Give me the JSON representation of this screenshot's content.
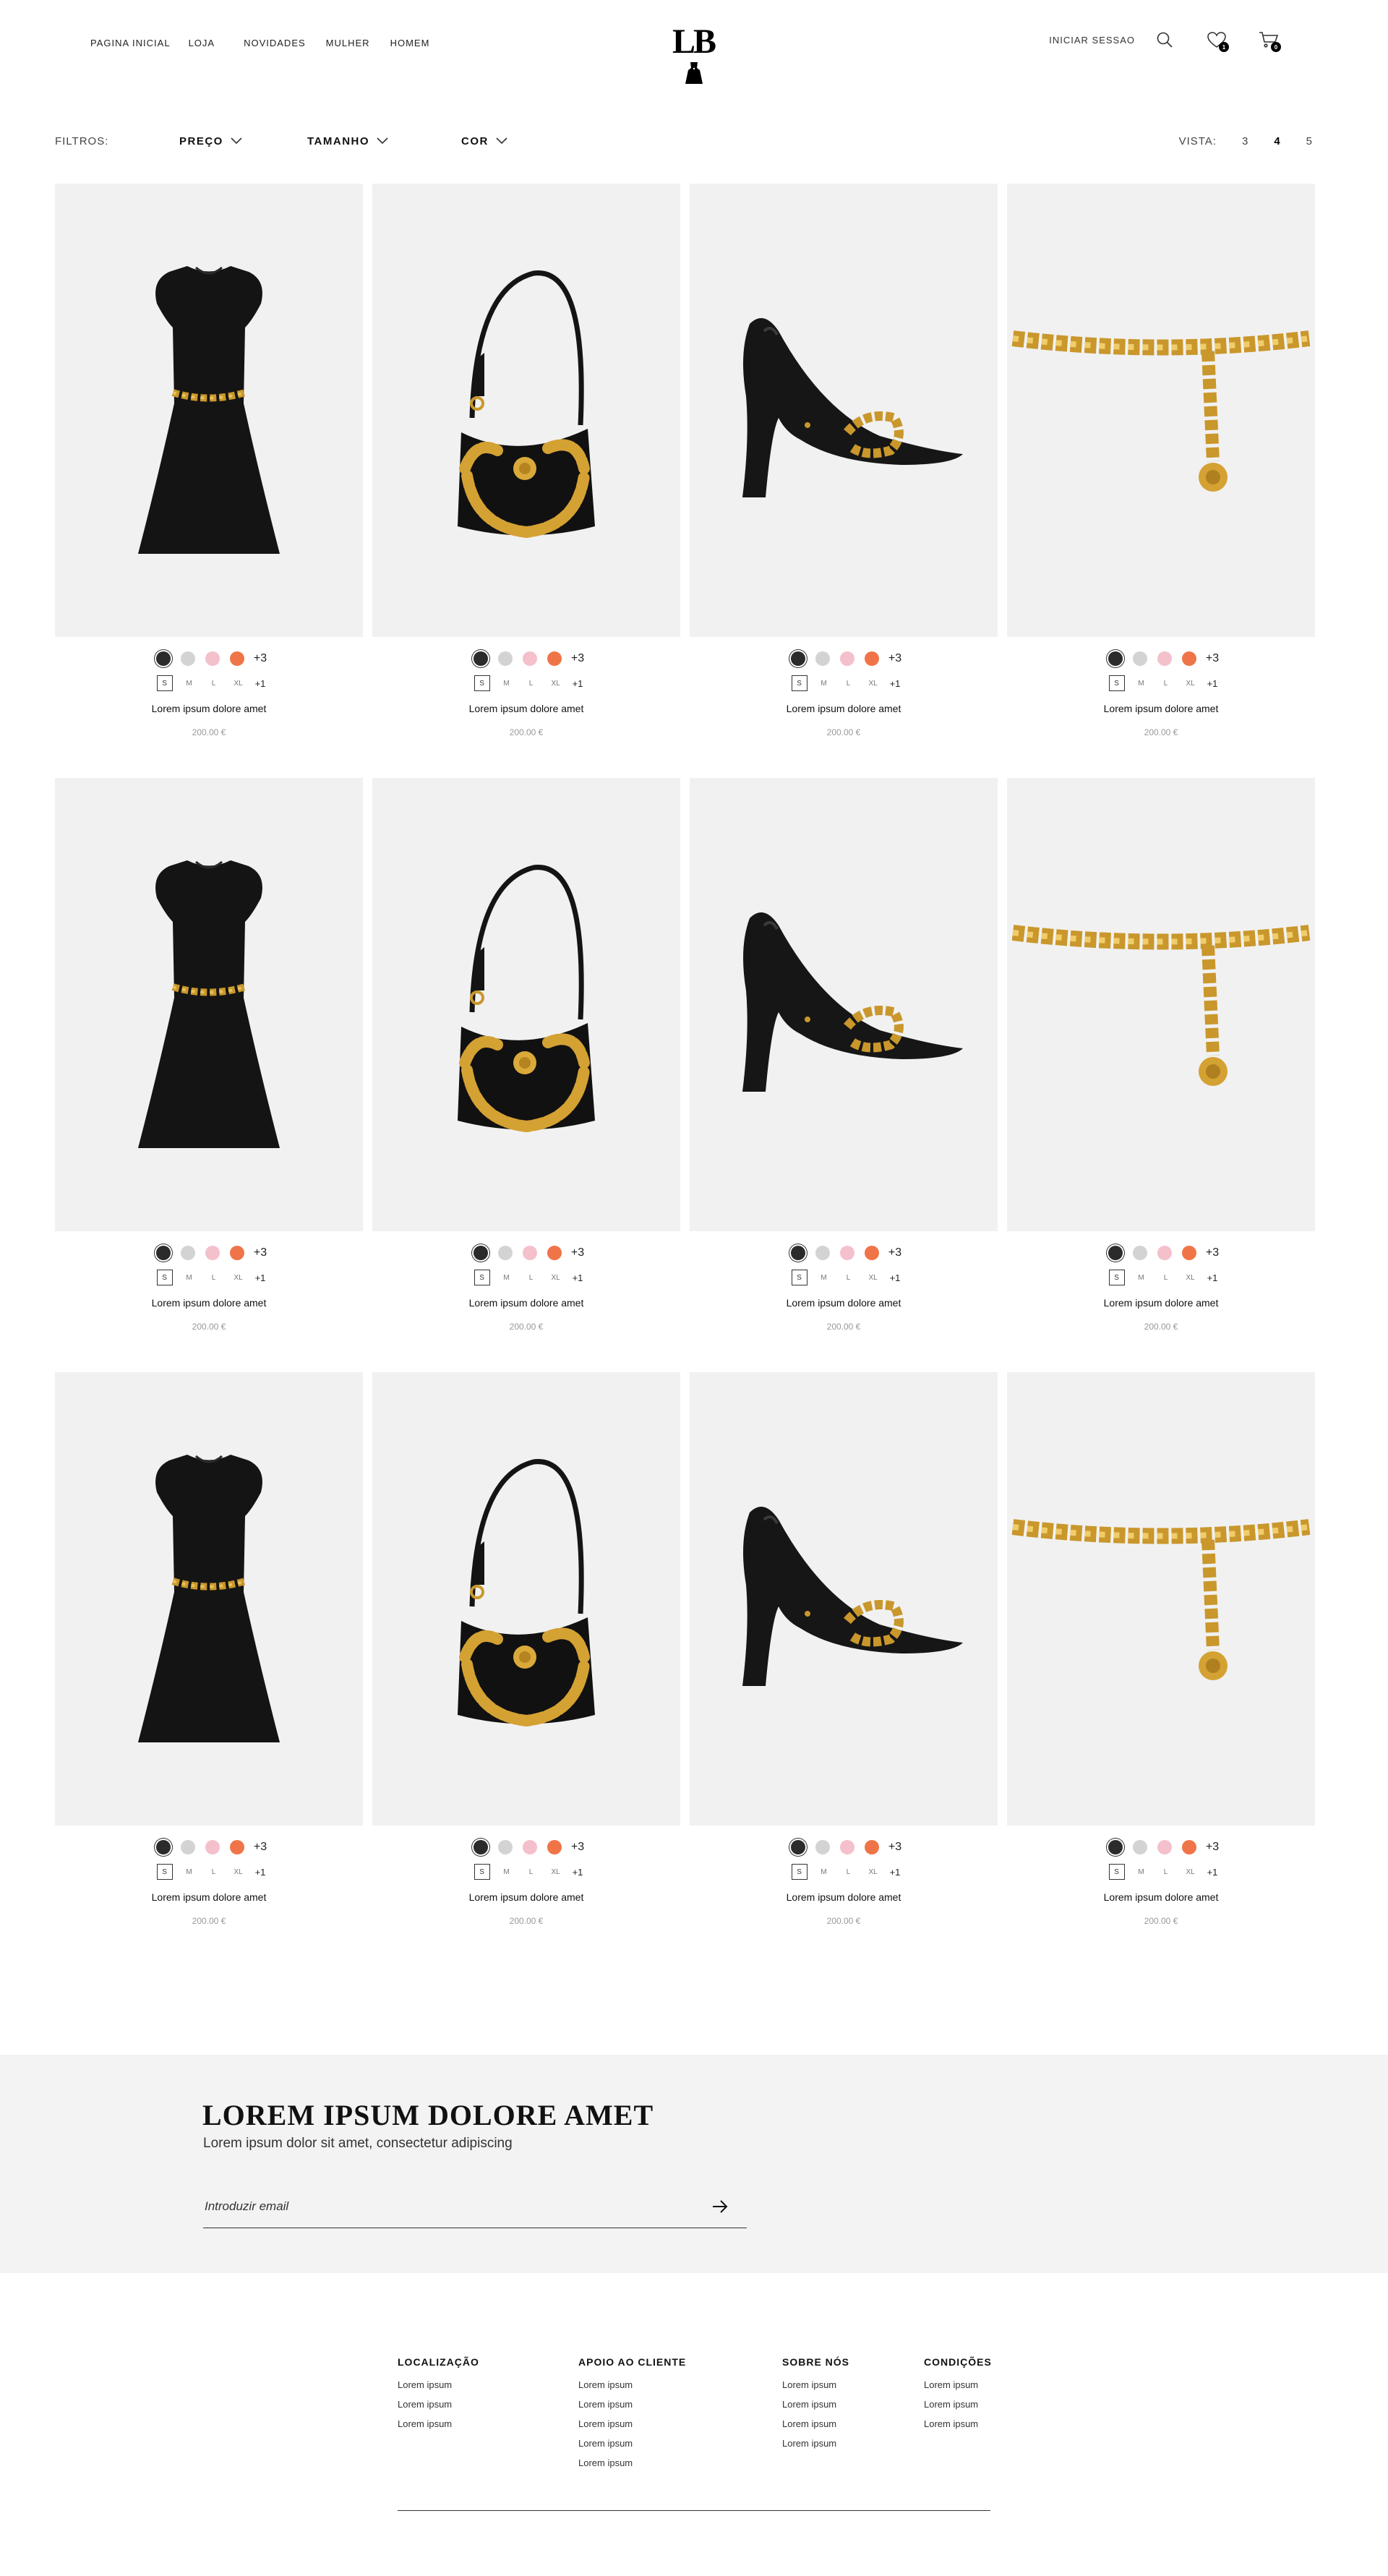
{
  "header": {
    "nav": [
      "PAGINA INICIAL",
      "LOJA",
      "NOVIDADES",
      "MULHER",
      "HOMEM"
    ],
    "logo": "LB",
    "login": "INICIAR SESSAO",
    "wishlist_count": "1",
    "cart_count": "0"
  },
  "filters": {
    "label": "FILTROS:",
    "price": "PREÇO",
    "size": "TAMANHO",
    "color": "COR",
    "view_label": "VISTA:",
    "views": [
      "3",
      "4",
      "5"
    ],
    "active_view": "4"
  },
  "colors": {
    "swatches": [
      "#2b2b2b",
      "#d3d3d3",
      "#f4c0cb",
      "#ef7548"
    ],
    "panel_bg": "#f1f1f1",
    "newsletter_bg": "#f3f3f3"
  },
  "product_template": {
    "more_colors": "+3",
    "sizes": [
      "S",
      "M",
      "L",
      "XL"
    ],
    "more_sizes": "+1",
    "name": "Lorem ipsum dolore amet",
    "price": "200.00 €"
  },
  "products": [
    {
      "kind": "dress"
    },
    {
      "kind": "bag"
    },
    {
      "kind": "heel"
    },
    {
      "kind": "necklace"
    },
    {
      "kind": "dress"
    },
    {
      "kind": "bag"
    },
    {
      "kind": "heel"
    },
    {
      "kind": "necklace"
    },
    {
      "kind": "dress"
    },
    {
      "kind": "bag"
    },
    {
      "kind": "heel"
    },
    {
      "kind": "necklace"
    }
  ],
  "newsletter": {
    "title": "LOREM IPSUM DOLORE AMET",
    "subtitle": "Lorem ipsum dolor sit amet, consectetur adipiscing",
    "placeholder": "Introduzir email"
  },
  "footer": {
    "columns": [
      {
        "title": "LOCALIZAÇÃO",
        "links": [
          "Lorem ipsum",
          "Lorem ipsum",
          "Lorem ipsum"
        ]
      },
      {
        "title": "APOIO AO CLIENTE",
        "links": [
          "Lorem ipsum",
          "Lorem ipsum",
          "Lorem ipsum",
          "Lorem ipsum",
          "Lorem ipsum"
        ]
      },
      {
        "title": "SOBRE NÓS",
        "links": [
          "Lorem ipsum",
          "Lorem ipsum",
          "Lorem ipsum",
          "Lorem ipsum"
        ]
      },
      {
        "title": "CONDIÇÕES",
        "links": [
          "Lorem ipsum",
          "Lorem ipsum",
          "Lorem ipsum"
        ]
      }
    ]
  }
}
